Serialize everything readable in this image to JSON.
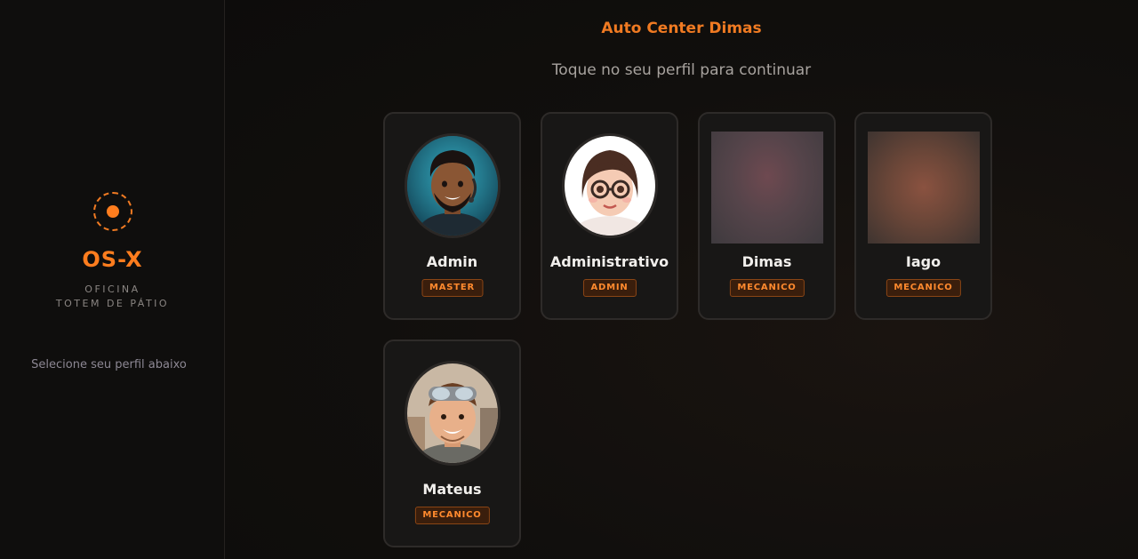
{
  "sidebar": {
    "brand_name": "OS-X",
    "brand_line1": "OFICINA",
    "brand_line2": "TOTEM DE PÁTIO",
    "hint": "Selecione seu perfil abaixo"
  },
  "header": {
    "shop_name": "Auto Center Dimas",
    "subtitle": "Toque no seu perfil para continuar"
  },
  "profiles": [
    {
      "name": "Admin",
      "role": "MASTER",
      "avatar": "cartoon-man-headset-avatar"
    },
    {
      "name": "Administrativo",
      "role": "ADMIN",
      "avatar": "cartoon-woman-glasses-avatar"
    },
    {
      "name": "Dimas",
      "role": "MECANICO",
      "avatar": "blurred-photo-avatar"
    },
    {
      "name": "Iago",
      "role": "MECANICO",
      "avatar": "blurred-photo-avatar"
    },
    {
      "name": "Mateus",
      "role": "MECANICO",
      "avatar": "cartoon-mechanic-goggles-avatar"
    }
  ],
  "colors": {
    "accent": "#ff7d1e",
    "background": "#0e0d0c",
    "card": "#181716",
    "badge_bg": "#3a1e0c"
  }
}
